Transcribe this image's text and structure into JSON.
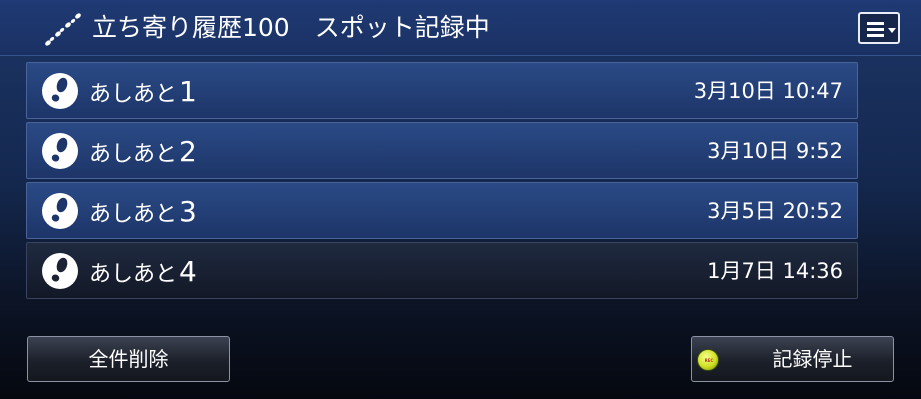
{
  "header": {
    "title": "立ち寄り履歴100　スポット記録中",
    "icon": "footprints-icon",
    "menu_icon": "menu-icon"
  },
  "list": {
    "items": [
      {
        "label": "あしあと",
        "number": "1",
        "time": "3月10日 10:47",
        "icon": "footprint-icon"
      },
      {
        "label": "あしあと",
        "number": "2",
        "time": "3月10日 9:52",
        "icon": "footprint-icon"
      },
      {
        "label": "あしあと",
        "number": "3",
        "time": "3月5日 20:52",
        "icon": "footprint-icon"
      },
      {
        "label": "あしあと",
        "number": "4",
        "time": "1月7日 14:36",
        "icon": "footprint-icon"
      }
    ]
  },
  "footer": {
    "delete_all_label": "全件削除",
    "stop_label": "記録停止",
    "rec_badge": "REC"
  },
  "colors": {
    "header_bg": "#1f3a74",
    "row_bg": "#2a4a86",
    "rec_accent": "#cfe023"
  }
}
